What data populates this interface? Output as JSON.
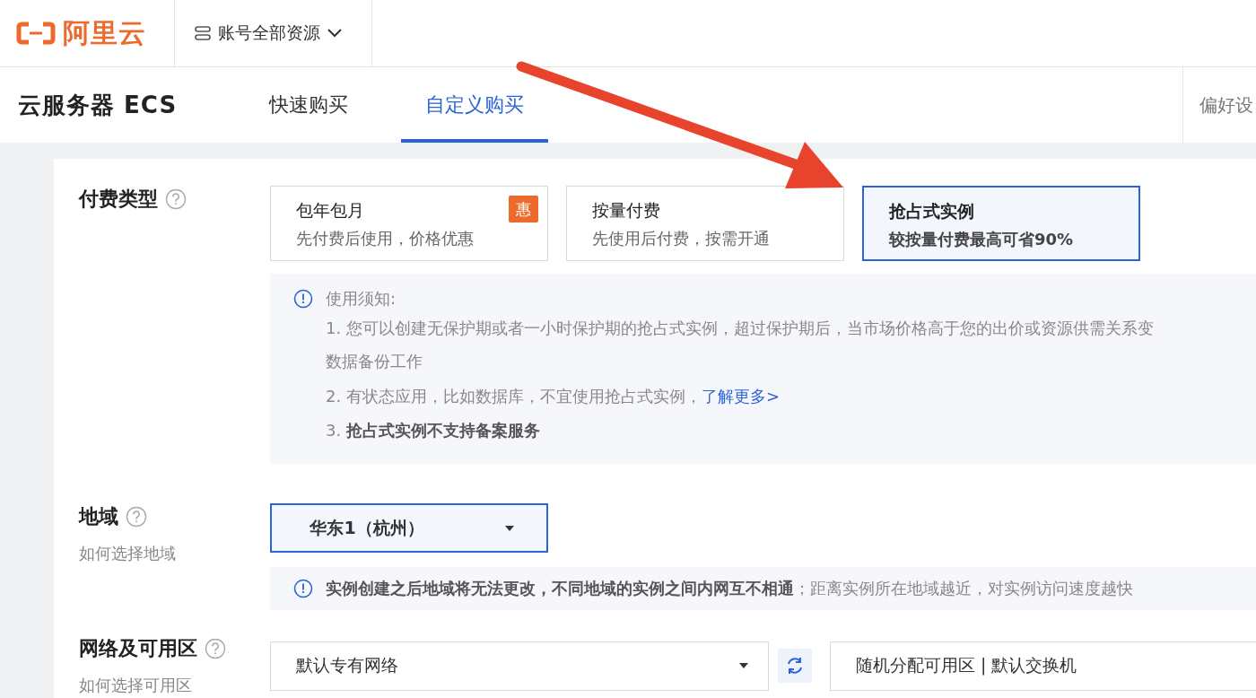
{
  "header": {
    "logo_text": "阿里云",
    "resource_menu": "账号全部资源"
  },
  "product_bar": {
    "title": "云服务器 ECS",
    "tabs": [
      {
        "label": "快速购买",
        "selected": false
      },
      {
        "label": "自定义购买",
        "selected": true
      }
    ],
    "preferences": "偏好设"
  },
  "billing": {
    "label": "付费类型",
    "options": [
      {
        "title": "包年包月",
        "subtitle": "先付费后使用，价格优惠",
        "badge": "惠",
        "selected": false
      },
      {
        "title": "按量付费",
        "subtitle": "先使用后付费，按需开通",
        "selected": false
      },
      {
        "title": "抢占式实例",
        "subtitle": "较按量付费最高可省90%",
        "selected": true
      }
    ],
    "notice": {
      "heading": "使用须知:",
      "lines": [
        {
          "kind": "item",
          "text": "1. 您可以创建无保护期或者一小时保护期的抢占式实例，超过保护期后，当市场价格高于您的出价或资源供需关系变"
        },
        {
          "kind": "continuation",
          "text": "数据备份工作"
        },
        {
          "kind": "item",
          "text": "2. 有状态应用，比如数据库，不宜使用抢占式实例，",
          "link": "了解更多>"
        },
        {
          "kind": "item",
          "text": "3. **抢占式实例不支持备案服务**"
        }
      ]
    }
  },
  "region": {
    "label": "地域",
    "help_link": "如何选择地域",
    "value": "华东1（杭州）",
    "notice": "**实例创建之后地域将无法更改，不同地域的实例之间内网互不相通**；距离实例所在地域越近，对实例访问速度越快"
  },
  "network": {
    "label": "网络及可用区",
    "help_link": "如何选择可用区",
    "vpc": "默认专有网络",
    "zone": "随机分配可用区 | 默认交换机"
  },
  "annotations": [
    {
      "kind": "arrow"
    }
  ]
}
